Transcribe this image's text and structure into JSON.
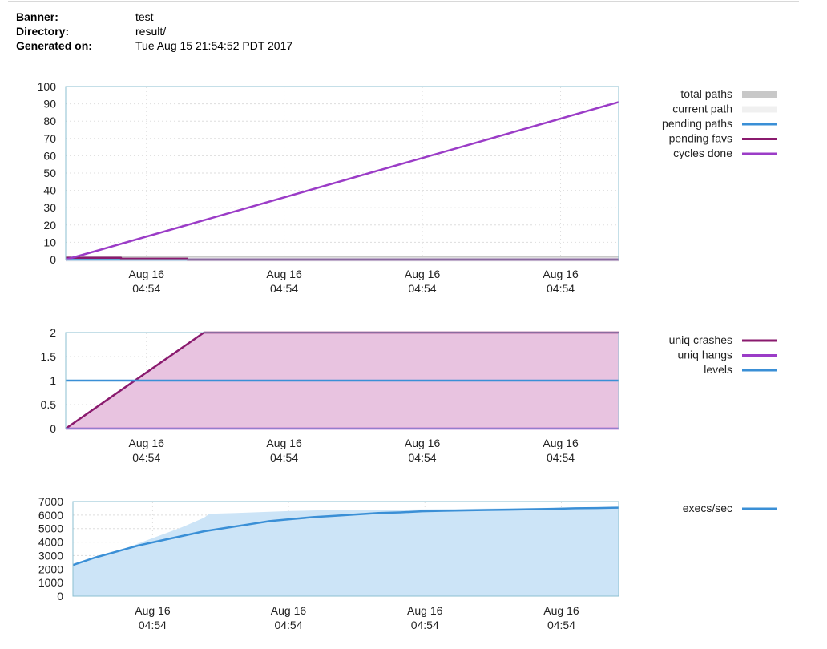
{
  "header": {
    "rows": [
      {
        "label": "Banner:",
        "value": "test"
      },
      {
        "label": "Directory:",
        "value": "result/"
      },
      {
        "label": "Generated on:",
        "value": "Tue Aug 15 21:54:52 PDT 2017"
      }
    ]
  },
  "colors": {
    "total_paths": "#c8c8c8",
    "current_path": "#f0f0f0",
    "pending_paths": "#3a8fd6",
    "pending_favs": "#8a1a6e",
    "cycles_done": "#9b3cc7",
    "uniq_crashes": "#8a1a6e",
    "uniq_hangs": "#9b3cc7",
    "levels": "#3a8fd6",
    "crash_fill": "#e8c3e0",
    "execs": "#3a8fd6",
    "execs_fill": "#cce4f7",
    "frame": "#8bbfd0",
    "grid": "#dddddd"
  },
  "chart_data": [
    {
      "type": "line",
      "x_ticks": [
        [
          "Aug 16",
          "04:54"
        ],
        [
          "Aug 16",
          "04:54"
        ],
        [
          "Aug 16",
          "04:54"
        ],
        [
          "Aug 16",
          "04:54"
        ]
      ],
      "x_tick_positions": [
        0.146,
        0.395,
        0.645,
        0.895
      ],
      "ylim": [
        0,
        100
      ],
      "y_ticks": [
        0,
        10,
        20,
        30,
        40,
        50,
        60,
        70,
        80,
        90,
        100
      ],
      "grid": true,
      "legend_position": "right",
      "series": [
        {
          "name": "total paths",
          "key": "total_paths",
          "style": "band",
          "x": [
            0,
            1
          ],
          "values": [
            1,
            1
          ]
        },
        {
          "name": "current path",
          "key": "current_path",
          "style": "band",
          "x": [
            0,
            1
          ],
          "values": [
            0,
            0
          ]
        },
        {
          "name": "pending paths",
          "key": "pending_paths",
          "style": "line",
          "x": [
            0,
            0.22,
            0.22,
            1
          ],
          "values": [
            0,
            0,
            0,
            0
          ]
        },
        {
          "name": "pending favs",
          "key": "pending_favs",
          "style": "line",
          "x": [
            0,
            0.1,
            0.1,
            0.22,
            0.22,
            1
          ],
          "values": [
            1,
            1,
            0.5,
            0.5,
            0,
            0
          ]
        },
        {
          "name": "cycles done",
          "key": "cycles_done",
          "style": "line",
          "x": [
            0,
            1
          ],
          "values": [
            0,
            91
          ]
        }
      ]
    },
    {
      "type": "area",
      "x_ticks": [
        [
          "Aug 16",
          "04:54"
        ],
        [
          "Aug 16",
          "04:54"
        ],
        [
          "Aug 16",
          "04:54"
        ],
        [
          "Aug 16",
          "04:54"
        ]
      ],
      "x_tick_positions": [
        0.146,
        0.395,
        0.645,
        0.895
      ],
      "ylim": [
        0,
        2
      ],
      "y_ticks": [
        0,
        0.5,
        1,
        1.5,
        2
      ],
      "y_tick_labels": [
        "0",
        "0.5",
        "1",
        "1.5",
        "2"
      ],
      "grid": true,
      "legend_position": "right",
      "series": [
        {
          "name": "uniq crashes",
          "key": "uniq_crashes",
          "style": "filled",
          "x": [
            0,
            0.25,
            1
          ],
          "values": [
            0,
            2,
            2
          ]
        },
        {
          "name": "uniq hangs",
          "key": "uniq_hangs",
          "style": "line",
          "x": [
            0,
            1
          ],
          "values": [
            0,
            0
          ]
        },
        {
          "name": "levels",
          "key": "levels",
          "style": "line",
          "x": [
            0,
            1
          ],
          "values": [
            1,
            1
          ]
        }
      ]
    },
    {
      "type": "area",
      "x_ticks": [
        [
          "Aug 16",
          "04:54"
        ],
        [
          "Aug 16",
          "04:54"
        ],
        [
          "Aug 16",
          "04:54"
        ],
        [
          "Aug 16",
          "04:54"
        ]
      ],
      "x_tick_positions": [
        0.146,
        0.395,
        0.645,
        0.895
      ],
      "ylim": [
        0,
        7000
      ],
      "y_ticks": [
        0,
        1000,
        2000,
        3000,
        4000,
        5000,
        6000,
        7000
      ],
      "grid": true,
      "legend_position": "right",
      "envelope": {
        "x": [
          0,
          0.04,
          0.08,
          0.12,
          0.16,
          0.2,
          0.24,
          0.25,
          0.3,
          0.4,
          0.5,
          0.6,
          0.7,
          0.8,
          0.9,
          1
        ],
        "values": [
          2300,
          2800,
          3300,
          3900,
          4500,
          5100,
          5800,
          6100,
          6150,
          6300,
          6400,
          6400,
          6450,
          6500,
          6550,
          6600
        ]
      },
      "series": [
        {
          "name": "execs/sec",
          "key": "execs",
          "style": "line",
          "x": [
            0,
            0.04,
            0.08,
            0.12,
            0.16,
            0.2,
            0.24,
            0.28,
            0.32,
            0.36,
            0.4,
            0.44,
            0.48,
            0.52,
            0.56,
            0.6,
            0.64,
            0.68,
            0.72,
            0.76,
            0.8,
            0.84,
            0.88,
            0.92,
            0.96,
            1
          ],
          "values": [
            2300,
            2850,
            3300,
            3750,
            4100,
            4450,
            4800,
            5050,
            5300,
            5550,
            5700,
            5850,
            5950,
            6050,
            6150,
            6200,
            6280,
            6320,
            6350,
            6380,
            6400,
            6430,
            6460,
            6500,
            6520,
            6550
          ]
        }
      ]
    }
  ]
}
